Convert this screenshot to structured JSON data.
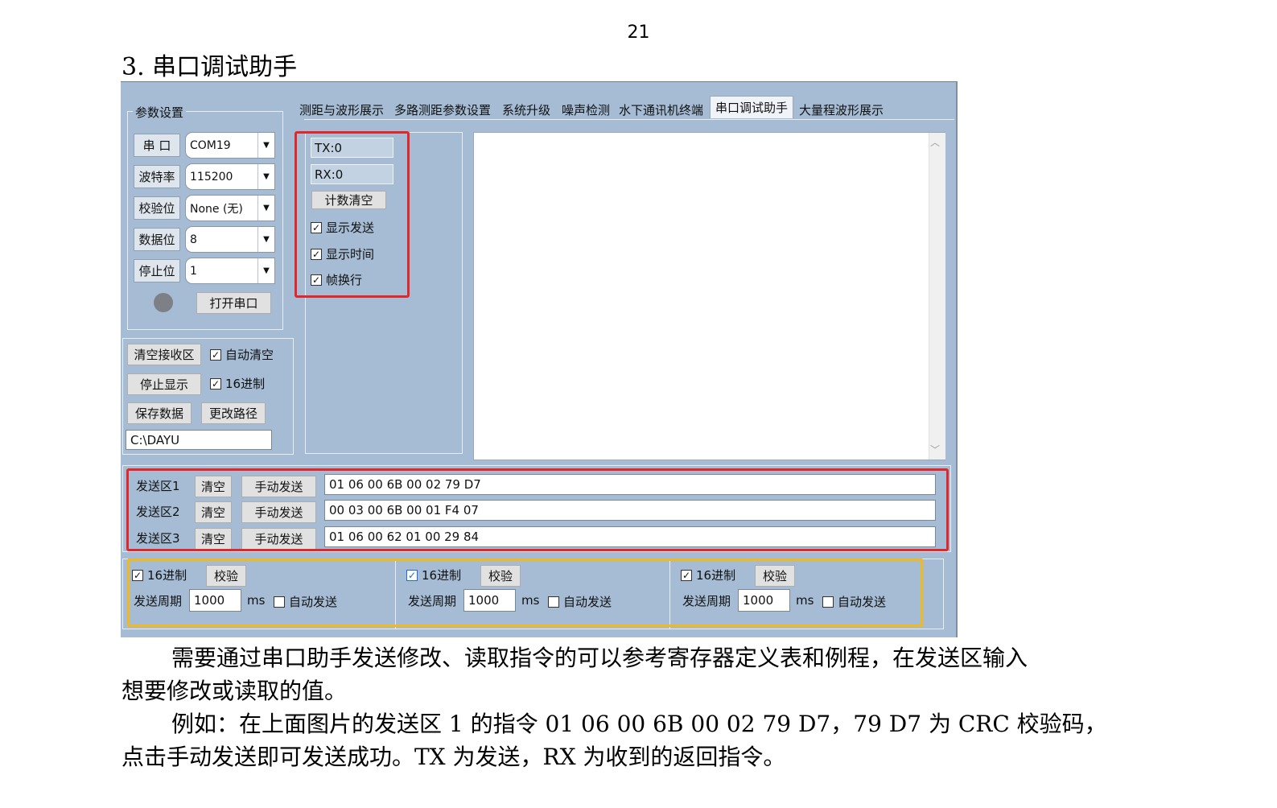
{
  "page_number": "21",
  "section_title": "3. 串口调试助手",
  "app": {
    "tabs": [
      "测距与波形展示",
      "多路测距参数设置",
      "系统升级",
      "噪声检测",
      "水下通讯机终端",
      "串口调试助手",
      "大量程波形展示"
    ],
    "active_tab": "串口调试助手",
    "params": {
      "title": "参数设置",
      "rows": [
        {
          "label": "串 口",
          "value": "COM19"
        },
        {
          "label": "波特率",
          "value": "115200"
        },
        {
          "label": "校验位",
          "value": "None (无)"
        },
        {
          "label": "数据位",
          "value": "8"
        },
        {
          "label": "停止位",
          "value": "1"
        }
      ],
      "open_button": "打开串口"
    },
    "recv": {
      "clear_button": "清空接收区",
      "auto_clear": "自动清空",
      "stop_button": "停止显示",
      "hex": "16进制",
      "save_button": "保存数据",
      "path_button": "更改路径",
      "path_value": "C:\\DAYU"
    },
    "counters": {
      "tx": "TX:0",
      "rx": "RX:0",
      "reset_button": "计数清空",
      "show_send": "显示发送",
      "show_time": "显示时间",
      "frame_newline": "帧换行"
    },
    "send_rows": [
      {
        "label": "发送区1",
        "clear": "清空",
        "send": "手动发送",
        "value": "01 06 00 6B 00 02 79 D7"
      },
      {
        "label": "发送区2",
        "clear": "清空",
        "send": "手动发送",
        "value": "00 03 00 6B 00 01 F4 07"
      },
      {
        "label": "发送区3",
        "clear": "清空",
        "send": "手动发送",
        "value": "01 06 00 62 01 00 29 84"
      }
    ],
    "options": [
      {
        "hex": "16进制",
        "check": "校验",
        "period_label": "发送周期",
        "period": "1000",
        "unit": "ms",
        "auto": "自动发送"
      },
      {
        "hex": "16进制",
        "check": "校验",
        "period_label": "发送周期",
        "period": "1000",
        "unit": "ms",
        "auto": "自动发送"
      },
      {
        "hex": "16进制",
        "check": "校验",
        "period_label": "发送周期",
        "period": "1000",
        "unit": "ms",
        "auto": "自动发送"
      }
    ]
  },
  "paragraph1": {
    "line1": "需要通过串口助手发送修改、读取指令的可以参考寄存器定义表和例程，在发送区输入",
    "line2": "想要修改或读取的值。"
  },
  "paragraph2": {
    "line1": "例如：在上面图片的发送区 1 的指令 01 06 00 6B 00 02 79 D7，79 D7 为 CRC 校验码，",
    "line2": "点击手动发送即可发送成功。TX 为发送，RX 为收到的返回指令。"
  },
  "colors": {
    "window_bg": "#a5bcd4",
    "highlight_red": "#e2262a",
    "highlight_yellow": "#f1b91d"
  },
  "icons": [
    "dropdown-arrow-icon",
    "status-led-icon",
    "checkmark-icon",
    "scroll-up-icon",
    "scroll-down-icon"
  ]
}
